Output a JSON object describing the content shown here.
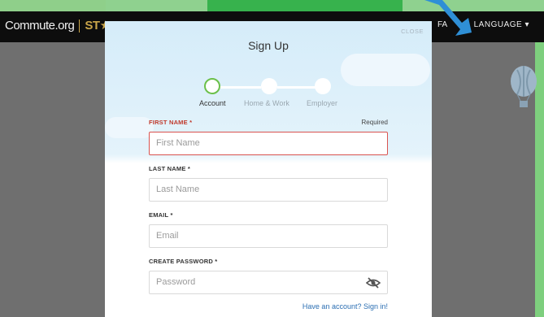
{
  "header": {
    "logo_text": "Commute.org",
    "logo_badge": "ST",
    "nav_partial": "FA",
    "language_label": "LANGUAGE"
  },
  "modal": {
    "close_label": "CLOSE",
    "title": "Sign Up",
    "steps": [
      {
        "label": "Account",
        "state": "active"
      },
      {
        "label": "Home & Work",
        "state": "inactive"
      },
      {
        "label": "Employer",
        "state": "inactive"
      }
    ],
    "required_note": "Required",
    "fields": {
      "first_name": {
        "label": "FIRST NAME *",
        "placeholder": "First Name"
      },
      "last_name": {
        "label": "LAST NAME *",
        "placeholder": "Last Name"
      },
      "email": {
        "label": "EMAIL *",
        "placeholder": "Email"
      },
      "password": {
        "label": "CREATE PASSWORD *",
        "placeholder": "Password"
      }
    },
    "signin_link": "Have an account? Sign in!"
  },
  "colors": {
    "accent_green": "#6cc04a",
    "error_red": "#d9534f",
    "link_blue": "#2c6fb3",
    "gold": "#c9a54a"
  }
}
